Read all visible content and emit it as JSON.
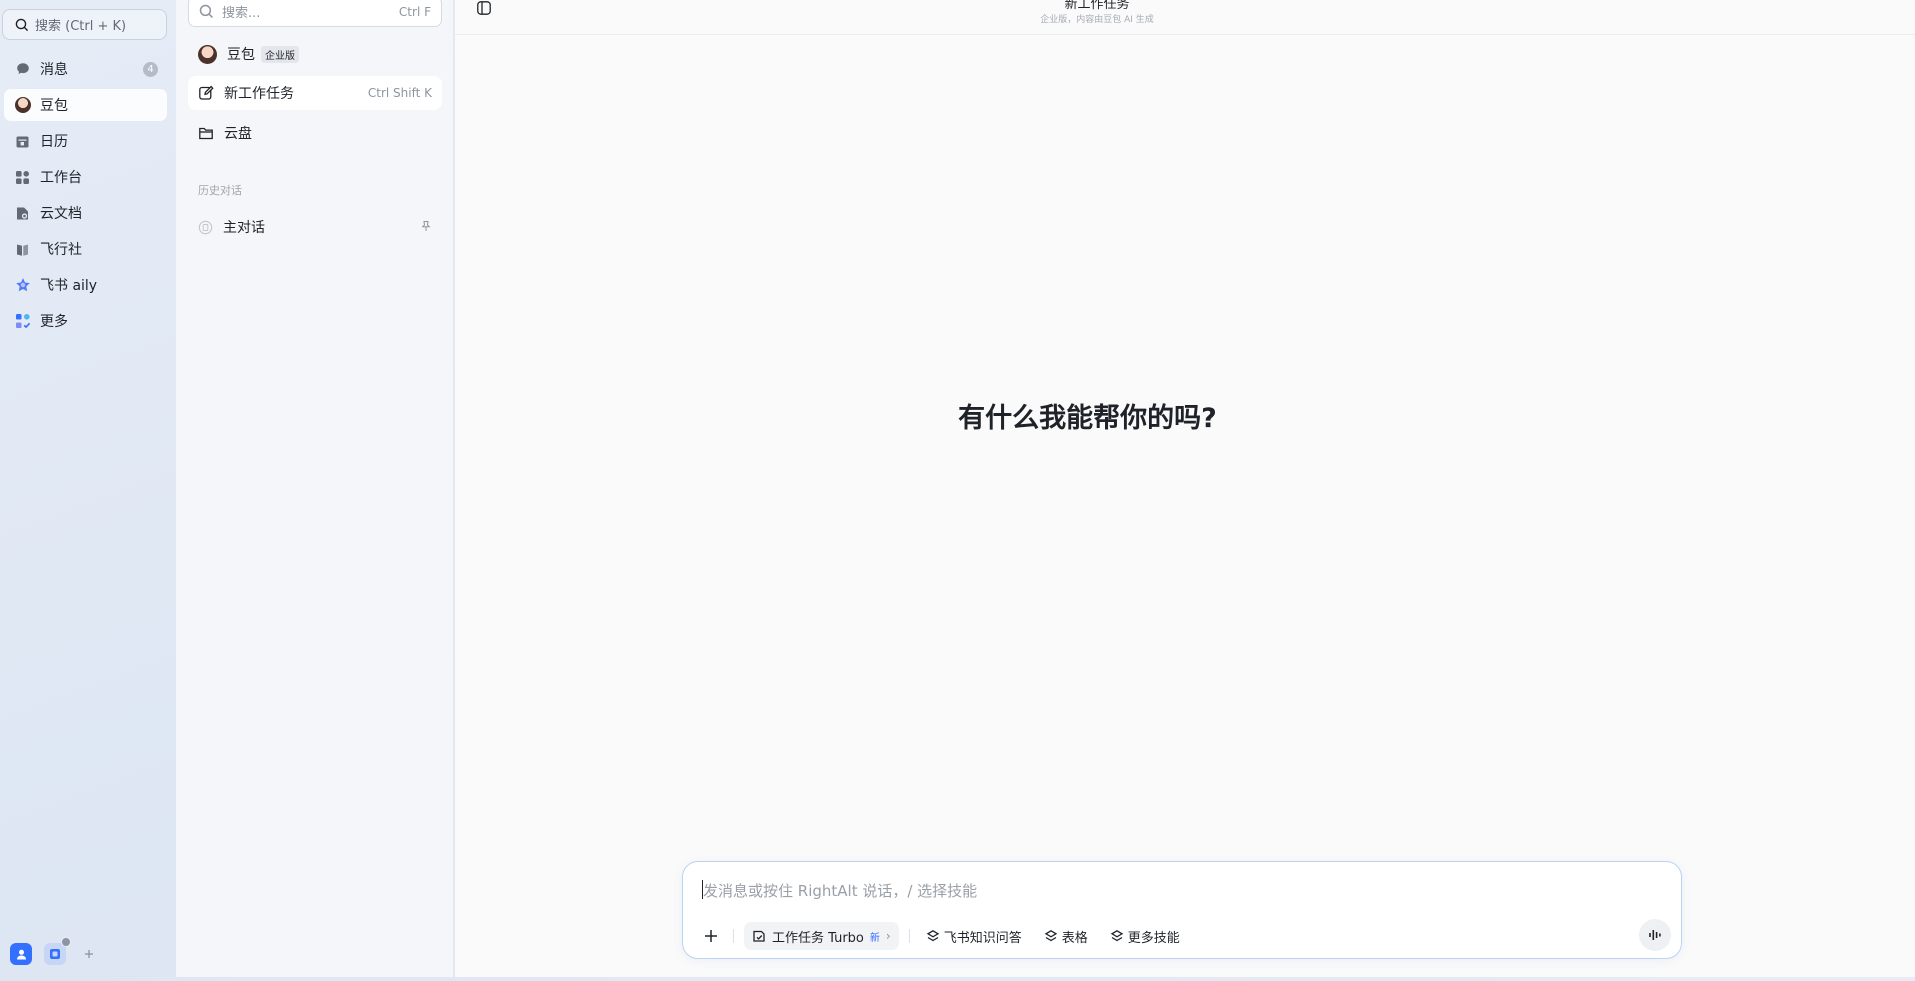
{
  "rail": {
    "search_label": "搜索 (Ctrl + K)",
    "items": [
      {
        "label": "消息",
        "badge": "4",
        "icon": "chat-icon"
      },
      {
        "label": "豆包",
        "icon": "doubao-avatar-icon",
        "active": true
      },
      {
        "label": "日历",
        "icon": "calendar-icon"
      },
      {
        "label": "工作台",
        "icon": "apps-grid-icon"
      },
      {
        "label": "云文档",
        "icon": "docs-icon"
      },
      {
        "label": "飞行社",
        "icon": "book-icon"
      },
      {
        "label": "飞书 aily",
        "icon": "aily-icon"
      },
      {
        "label": "更多",
        "icon": "more-apps-icon"
      }
    ]
  },
  "panel": {
    "search_placeholder": "搜索...",
    "search_shortcut": "Ctrl F",
    "doubao_label": "豆包",
    "doubao_tag": "企业版",
    "new_task_label": "新工作任务",
    "new_task_shortcut": "Ctrl Shift K",
    "cloud_label": "云盘",
    "history_section": "历史对话",
    "history_items": [
      {
        "label": "主对话"
      }
    ]
  },
  "main": {
    "title": "新工作任务",
    "subtitle": "企业版，内容由豆包 AI 生成",
    "greeting": "有什么我能帮你的吗?"
  },
  "composer": {
    "placeholder": "发消息或按住 RightAlt 说话，/ 选择技能",
    "mode_label": "工作任务 Turbo",
    "mode_badge": "新",
    "skills": [
      "飞书知识问答",
      "表格",
      "更多技能"
    ]
  },
  "colors": {
    "accent": "#3370ff",
    "composer_border": "#bcd2f4"
  }
}
